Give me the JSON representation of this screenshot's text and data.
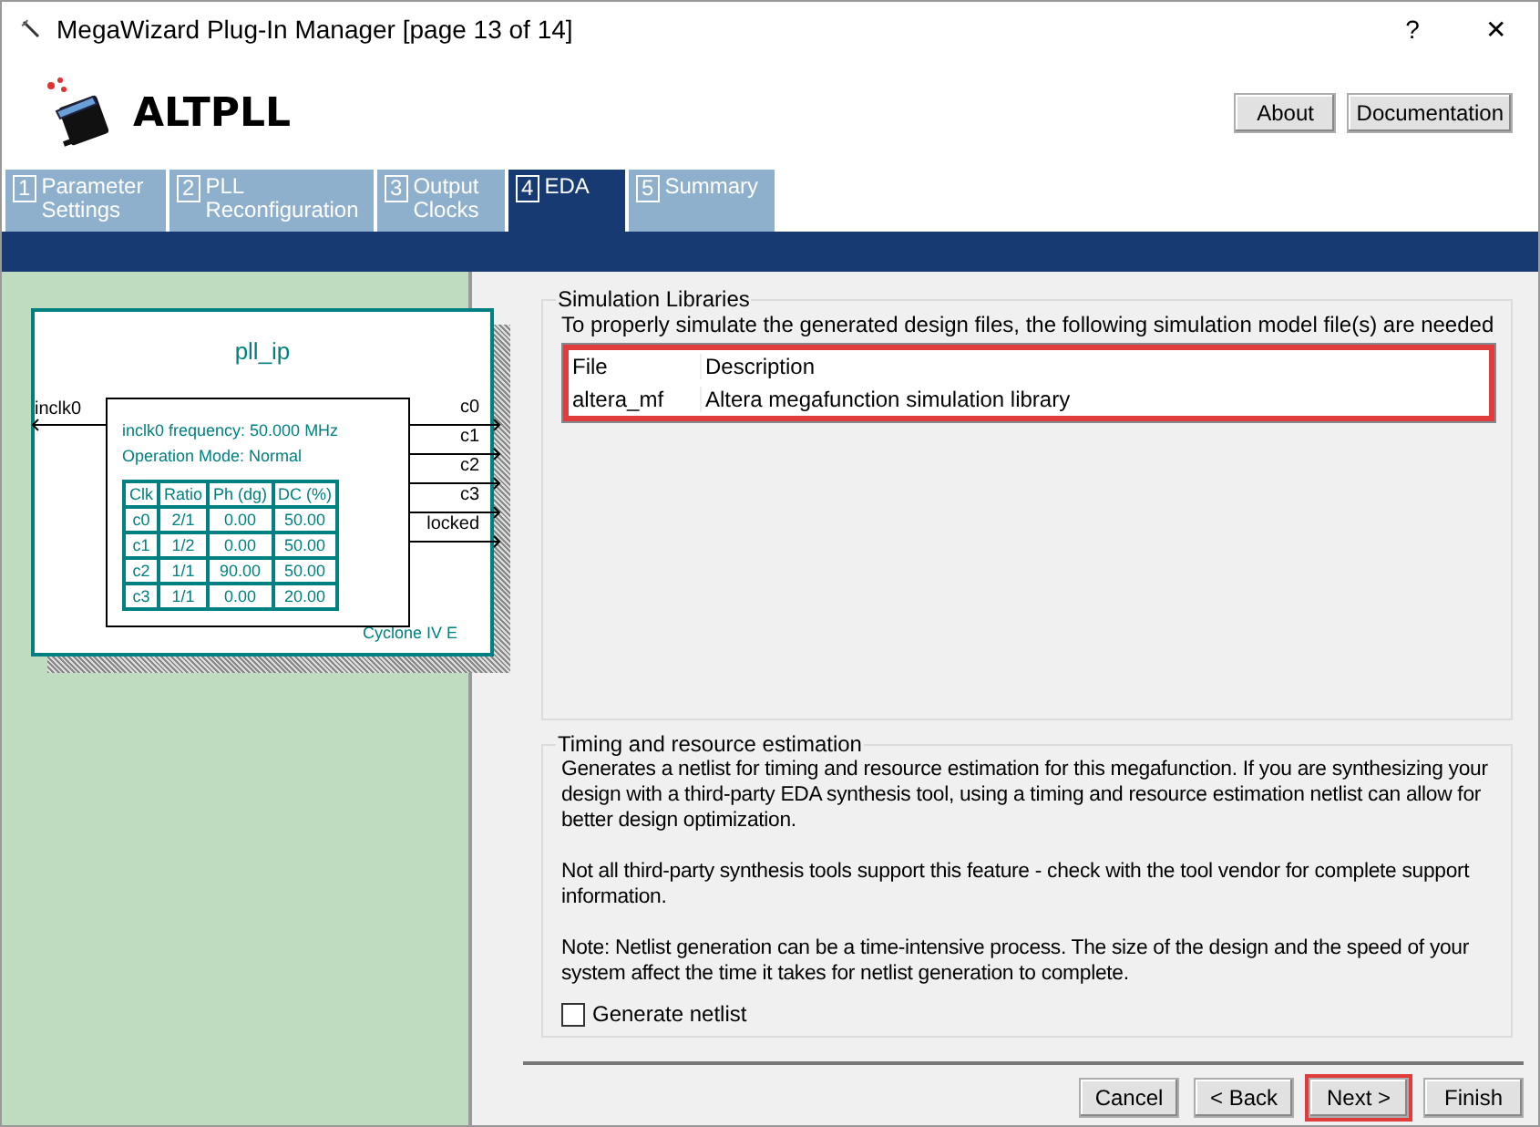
{
  "window": {
    "title": "MegaWizard Plug-In Manager [page 13 of 14]",
    "help": "?",
    "close": "✕"
  },
  "header": {
    "title": "ALTPLL",
    "buttons": [
      "About",
      "Documentation"
    ]
  },
  "tabs": [
    {
      "number": "1",
      "label": "Parameter Settings",
      "selected": false
    },
    {
      "number": "2",
      "label": "PLL Reconfiguration",
      "selected": false
    },
    {
      "number": "3",
      "label": "Output Clocks",
      "selected": false
    },
    {
      "number": "4",
      "label": "EDA",
      "selected": true
    },
    {
      "number": "5",
      "label": "Summary",
      "selected": false
    }
  ],
  "diagram": {
    "title": "pll_ip",
    "input": "inclk0",
    "info": [
      "inclk0 frequency: 50.000 MHz",
      "Operation Mode: Normal"
    ],
    "columns": [
      "Clk",
      "Ratio",
      "Ph (dg)",
      "DC (%)"
    ],
    "rows": [
      [
        "c0",
        "2/1",
        "0.00",
        "50.00"
      ],
      [
        "c1",
        "1/2",
        "0.00",
        "50.00"
      ],
      [
        "c2",
        "1/1",
        "90.00",
        "50.00"
      ],
      [
        "c3",
        "1/1",
        "0.00",
        "20.00"
      ]
    ],
    "outputs": [
      "c0",
      "c1",
      "c2",
      "c3",
      "locked"
    ],
    "device": "Cyclone IV E"
  },
  "simulation_libraries": {
    "title": "Simulation Libraries",
    "description": "To properly simulate the generated design files, the following simulation model file(s) are needed",
    "highlighted": true,
    "columns": [
      "File",
      "Description"
    ],
    "rows": [
      [
        "altera_mf",
        "Altera megafunction simulation library"
      ]
    ]
  },
  "timing": {
    "title": "Timing and resource estimation",
    "paragraphs": [
      "Generates a netlist for timing and resource estimation for this megafunction. If you are synthesizing your design with a third-party EDA synthesis tool, using a timing and resource estimation netlist can allow for better design optimization.",
      "Not all third-party synthesis tools support this feature - check with the tool vendor for complete support information.",
      "Note: Netlist generation can be a time-intensive process. The size of the design and the speed of your system affect the time it takes for netlist generation to complete."
    ],
    "checkbox": {
      "label": "Generate netlist",
      "checked": false
    }
  },
  "buttons": [
    {
      "label": "Cancel",
      "highlighted": false
    },
    {
      "label": "< Back",
      "highlighted": false
    },
    {
      "label": "Next >",
      "highlighted": true
    },
    {
      "label": "Finish",
      "highlighted": false
    }
  ]
}
